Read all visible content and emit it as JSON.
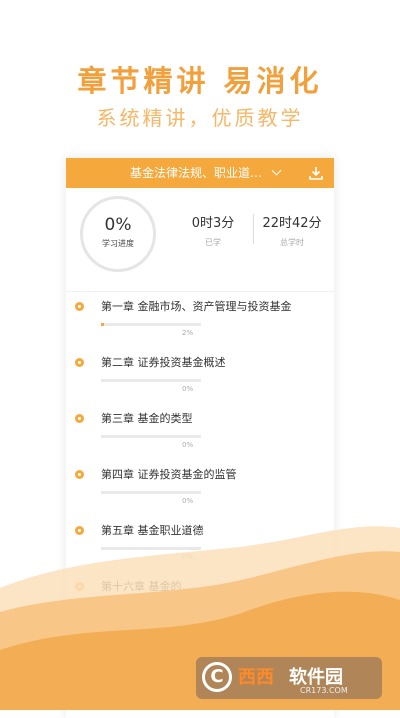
{
  "promo": {
    "headline": "章节精讲  易消化",
    "subline": "系统精讲，优质教学"
  },
  "course": {
    "title": "基金法律法规、职业道…",
    "download_icon": "download-icon",
    "dropdown_icon": "chevron-down-icon"
  },
  "progress": {
    "percent": "0%",
    "percent_label": "学习进度",
    "learned_value": "0时3分",
    "learned_label": "已学",
    "total_value": "22时42分",
    "total_label": "总学时"
  },
  "chapters": [
    {
      "title": "第一章 金融市场、资产管理与投资基金",
      "progress": "2%",
      "progress_fraction": 0.02
    },
    {
      "title": "第二章 证券投资基金概述",
      "progress": "0%",
      "progress_fraction": 0
    },
    {
      "title": "第三章 基金的类型",
      "progress": "0%",
      "progress_fraction": 0
    },
    {
      "title": "第四章 证券投资基金的监管",
      "progress": "0%",
      "progress_fraction": 0
    },
    {
      "title": "第五章 基金职业道德",
      "progress": "0%",
      "progress_fraction": 0
    },
    {
      "title": "第十六章 基金的...",
      "progress": "",
      "progress_fraction": 0
    }
  ],
  "watermark": {
    "logo": "C",
    "name_a": "西西",
    "name_b": "软件园",
    "url": "CR173.COM"
  },
  "colors": {
    "accent": "#f5a93d",
    "headline": "#f2a03c",
    "wave_light": "#f9d6a3",
    "wave_dark": "#f3ad55"
  }
}
